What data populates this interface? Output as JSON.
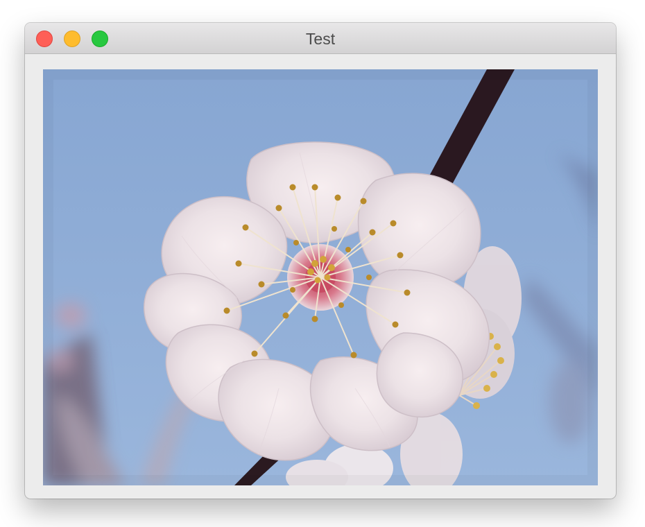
{
  "window": {
    "title": "Test",
    "buttons": [
      {
        "name": "close",
        "color": "#fe5f57"
      },
      {
        "name": "minimize",
        "color": "#febc2e"
      },
      {
        "name": "zoom",
        "color": "#28c840"
      }
    ]
  },
  "image": {
    "subject": "photo-plum-blossom",
    "palette": {
      "sky": "#8fadd5",
      "petal": "#efe6e9",
      "branch": "#2b1a20",
      "stamen": "#c8962a"
    }
  }
}
